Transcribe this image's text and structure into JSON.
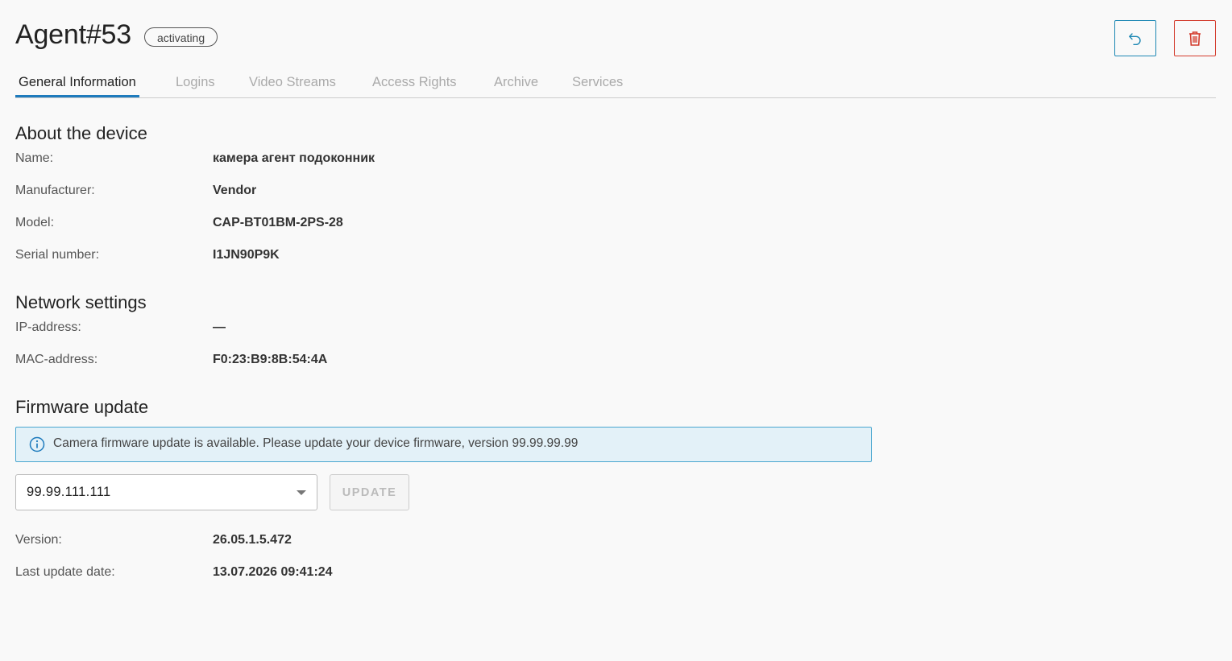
{
  "header": {
    "title": "Agent#53",
    "status_badge": "activating",
    "back_button_icon": "undo-arrow-icon",
    "delete_button_icon": "trash-icon",
    "colors": {
      "accent": "#1e7bbd",
      "danger": "#d33b2c"
    }
  },
  "tabs": [
    {
      "label": "General Information",
      "active": true
    },
    {
      "label": "Logins",
      "active": false
    },
    {
      "label": "Video Streams",
      "active": false
    },
    {
      "label": "Access Rights",
      "active": false
    },
    {
      "label": "Archive",
      "active": false
    },
    {
      "label": "Services",
      "active": false
    }
  ],
  "about": {
    "title": "About the device",
    "rows": [
      {
        "label": "Name:",
        "value": "камера агент подоконник"
      },
      {
        "label": "Manufacturer:",
        "value": "Vendor"
      },
      {
        "label": "Model:",
        "value": "CAP-BT01BM-2PS-28"
      },
      {
        "label": "Serial number:",
        "value": "I1JN90P9K"
      }
    ]
  },
  "network": {
    "title": "Network settings",
    "rows": [
      {
        "label": "IP-address:",
        "value": "—"
      },
      {
        "label": "MAC-address:",
        "value": "F0:23:B9:8B:54:4A"
      }
    ]
  },
  "firmware": {
    "title": "Firmware update",
    "info_message": "Camera firmware update is available. Please update your device firmware, version 99.99.99.99",
    "info_icon": "info-circle-icon",
    "selected_version": "99.99.111.111",
    "update_button": "UPDATE",
    "rows": [
      {
        "label": "Version:",
        "value": "26.05.1.5.472"
      },
      {
        "label": "Last update date:",
        "value": "13.07.2026 09:41:24"
      }
    ]
  }
}
